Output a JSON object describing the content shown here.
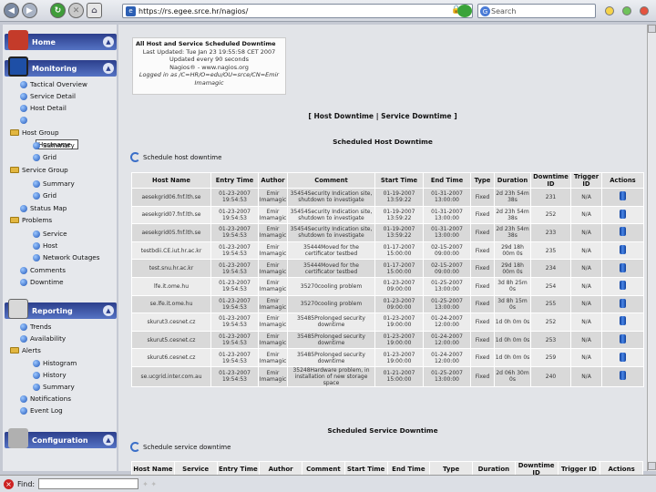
{
  "browser": {
    "url": "https://rs.egee.srce.hr/nagios/",
    "search_placeholder": "Search"
  },
  "sidebar": {
    "home": "Home",
    "monitoring": "Monitoring",
    "reporting": "Reporting",
    "configuration": "Configuration",
    "host_search_value": "Hostname",
    "monitoring_items": [
      "Tactical Overview",
      "Service Detail",
      "Host Detail"
    ],
    "host_group": "Host Group",
    "hg_sub": [
      "Summary",
      "Grid"
    ],
    "service_group": "Service Group",
    "sg_sub": [
      "Summary",
      "Grid"
    ],
    "status_map": "Status Map",
    "problems": "Problems",
    "problem_sub": [
      "Service",
      "Host",
      "Network Outages"
    ],
    "comments": "Comments",
    "downtime": "Downtime",
    "reporting_items": [
      "Trends",
      "Availability"
    ],
    "alerts": "Alerts",
    "alert_sub": [
      "Histogram",
      "History",
      "Summary"
    ],
    "notifications": "Notifications",
    "event_log": "Event Log"
  },
  "info": {
    "title": "All Host and Service Scheduled Downtime",
    "lines": [
      "Last Updated: Tue Jan 23 19:55:58 CET 2007",
      "Updated every 90 seconds",
      "Nagios® - www.nagios.org",
      "Logged in as /C=HR/O=edu/OU=srce/CN=Emir",
      "Imamagic"
    ]
  },
  "links": "[ Host Downtime | Service Downtime ]",
  "host_section": {
    "title": "Scheduled Host Downtime",
    "schedule": "Schedule host downtime"
  },
  "host_table": {
    "headers": [
      "Host Name",
      "Entry Time",
      "Author",
      "Comment",
      "Start Time",
      "End Time",
      "Type",
      "Duration",
      "Downtime ID",
      "Trigger ID",
      "Actions"
    ],
    "rows": [
      [
        "aesekgrid06.fnf.lth.se",
        "01-23-2007 19:54:53",
        "Emir Imamagic",
        "35454Security Indication site, shutdown to investigate",
        "01-19-2007 13:59:22",
        "01-31-2007 13:00:00",
        "Fixed",
        "2d 23h 54m 38s",
        "231",
        "N/A"
      ],
      [
        "aesekgrid07.fnf.lth.se",
        "01-23-2007 19:54:53",
        "Emir Imamagic",
        "35454Security Indication site, shutdown to investigate",
        "01-19-2007 13:59:22",
        "01-31-2007 13:00:00",
        "Fixed",
        "2d 23h 54m 38s",
        "252",
        "N/A"
      ],
      [
        "aesekgrid05.fnf.lth.se",
        "01-23-2007 19:54:53",
        "Emir Imamagic",
        "35454Security Indication site, shutdown to investigate",
        "01-19-2007 13:59:22",
        "01-31-2007 13:00:00",
        "Fixed",
        "2d 23h 54m 38s",
        "233",
        "N/A"
      ],
      [
        "testbdii.CE.iut.hr.ac.kr",
        "01-23-2007 19:54:53",
        "Emir Imamagic",
        "35444Moved for the certificator testbed",
        "01-17-2007 15:00:00",
        "02-15-2007 09:00:00",
        "Fixed",
        "29d 18h 00m 0s",
        "235",
        "N/A"
      ],
      [
        "test.snu.hr.ac.kr",
        "01-23-2007 19:54:53",
        "Emir Imamagic",
        "35444Moved for the certificator testbed",
        "01-17-2007 15:00:00",
        "02-15-2007 09:00:00",
        "Fixed",
        "29d 18h 00m 0s",
        "234",
        "N/A"
      ],
      [
        "lfe.it.ome.hu",
        "01-23-2007 19:54:53",
        "Emir Imamagic",
        "35270cooling problem",
        "01-23-2007 09:00:00",
        "01-25-2007 13:00:00",
        "Fixed",
        "3d 8h 25m 0s",
        "254",
        "N/A"
      ],
      [
        "se.lfe.it.ome.hu",
        "01-23-2007 19:54:53",
        "Emir Imamagic",
        "35270cooling problem",
        "01-23-2007 09:00:00",
        "01-25-2007 13:00:00",
        "Fixed",
        "3d 8h 15m 0s",
        "255",
        "N/A"
      ],
      [
        "skurut3.cesnet.cz",
        "01-23-2007 19:54:53",
        "Emir Imamagic",
        "35485Prolonged security downtime",
        "01-23-2007 19:00:00",
        "01-24-2007 12:00:00",
        "Fixed",
        "1d 0h 0m 0s",
        "252",
        "N/A"
      ],
      [
        "skurut5.cesnet.cz",
        "01-23-2007 19:54:53",
        "Emir Imamagic",
        "35485Prolonged security downtime",
        "01-23-2007 19:00:00",
        "01-24-2007 12:00:00",
        "Fixed",
        "1d 0h 0m 0s",
        "253",
        "N/A"
      ],
      [
        "skurut6.cesnet.cz",
        "01-23-2007 19:54:53",
        "Emir Imamagic",
        "35485Prolonged security downtime",
        "01-23-2007 19:00:00",
        "01-24-2007 12:00:00",
        "Fixed",
        "1d 0h 0m 0s",
        "259",
        "N/A"
      ],
      [
        "se.ucgrid.inter.com.au",
        "01-23-2007 19:54:53",
        "Emir Imamagic",
        "35248Hardware problem, in installation of new storage space",
        "01-21-2007 15:00:00",
        "01-25-2007 13:00:00",
        "Fixed",
        "2d 06h 30m 0s",
        "240",
        "N/A"
      ]
    ]
  },
  "service_section": {
    "title": "Scheduled Service Downtime",
    "schedule": "Schedule service downtime",
    "headers": [
      "Host Name",
      "Service",
      "Entry Time",
      "Author",
      "Comment",
      "Start Time",
      "End Time",
      "Type",
      "Duration",
      "Downtime ID",
      "Trigger ID",
      "Actions"
    ]
  },
  "status": {
    "find_label": "Find:"
  }
}
